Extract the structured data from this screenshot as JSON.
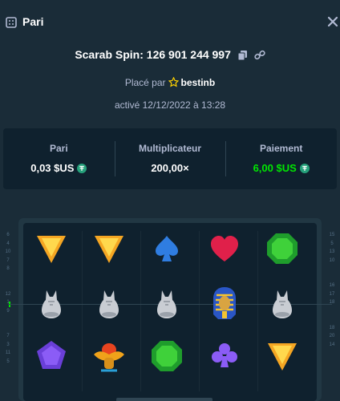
{
  "header": {
    "title": "Pari"
  },
  "spin": {
    "label": "Scarab Spin: 126 901 244 997"
  },
  "placed": {
    "prefix": "Placé par",
    "user": "bestinb"
  },
  "activated": {
    "text": "activé 12/12/2022 à 13:28"
  },
  "stats": [
    {
      "label": "Pari",
      "value": "0,03 $US",
      "currency_icon": "tether-icon"
    },
    {
      "label": "Multiplicateur",
      "value": "200,00×"
    },
    {
      "label": "Paiement",
      "value": "6,00 $US",
      "currency_icon": "tether-icon",
      "value_color": "#00e701"
    }
  ],
  "reels": [
    [
      "yellow-triangle",
      "cat-statue",
      "purple-pentagon"
    ],
    [
      "yellow-triangle",
      "cat-statue",
      "golden-scarab"
    ],
    [
      "blue-spade",
      "cat-statue",
      "green-gem"
    ],
    [
      "red-heart",
      "pharaoh",
      "purple-club"
    ],
    [
      "green-gem",
      "cat-statue",
      "yellow-triangle"
    ]
  ],
  "left_numbers": [
    "6",
    "4",
    "10",
    "7",
    "8",
    "",
    "",
    "12",
    "1",
    "9",
    "",
    "",
    "7",
    "3",
    "11",
    "5"
  ],
  "right_numbers": [
    "15",
    "5",
    "13",
    "10",
    "",
    "",
    "16",
    "17",
    "18",
    "",
    "",
    "18",
    "20",
    "14"
  ],
  "colors": {
    "win": "#00e701",
    "background": "#1a2c38",
    "panel": "#0f212e"
  }
}
